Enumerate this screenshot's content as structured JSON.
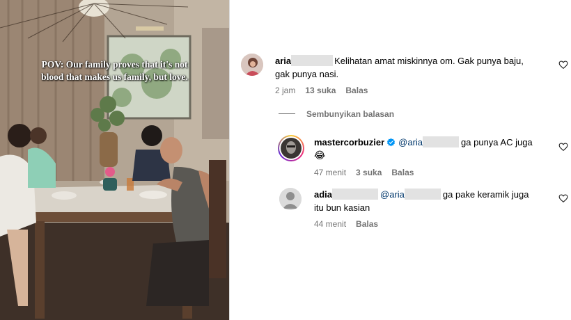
{
  "photo": {
    "caption_line1": "POV: Our family proves that it's not",
    "caption_line2": "blood that makes us family, but love."
  },
  "comments": [
    {
      "username": "aria",
      "text_line1": "Kelihatan amat miskinnya om. Gak punya baju,",
      "text_line2": "gak punya nasi.",
      "time": "2 jam",
      "likes": "13 suka",
      "reply": "Balas"
    },
    {
      "username": "mastercorbuzier",
      "verified": true,
      "mention": "@aria",
      "text": "ga punya AC juga",
      "emoji": "😂",
      "time": "47 menit",
      "likes": "3 suka",
      "reply": "Balas"
    },
    {
      "username": "adia",
      "mention": "@aria",
      "text_line1": "ga pake keramik juga",
      "text_line2": "itu bun kasian",
      "time": "44 menit",
      "reply": "Balas"
    }
  ],
  "hide_replies": "Sembunyikan balasan",
  "colors": {
    "link": "#00376b",
    "meta": "#737373",
    "verified": "#0095f6"
  }
}
